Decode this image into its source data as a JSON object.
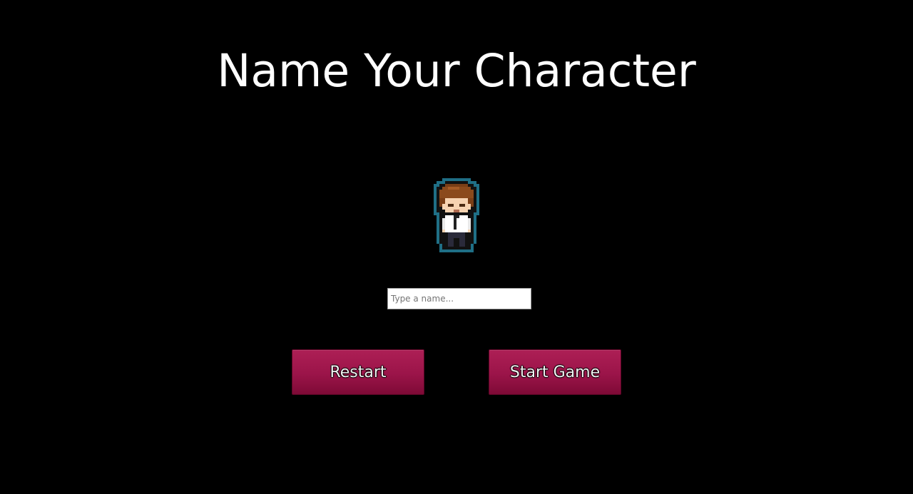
{
  "screen": {
    "title": "Name Your Character"
  },
  "character": {
    "sprite_icon": "pixel-character-sprite"
  },
  "name_input": {
    "value": "",
    "placeholder": "Type a name..."
  },
  "buttons": {
    "restart_label": "Restart",
    "start_label": "Start Game"
  },
  "colors": {
    "background": "#000000",
    "title": "#ffffff",
    "button": "#9b1449"
  }
}
